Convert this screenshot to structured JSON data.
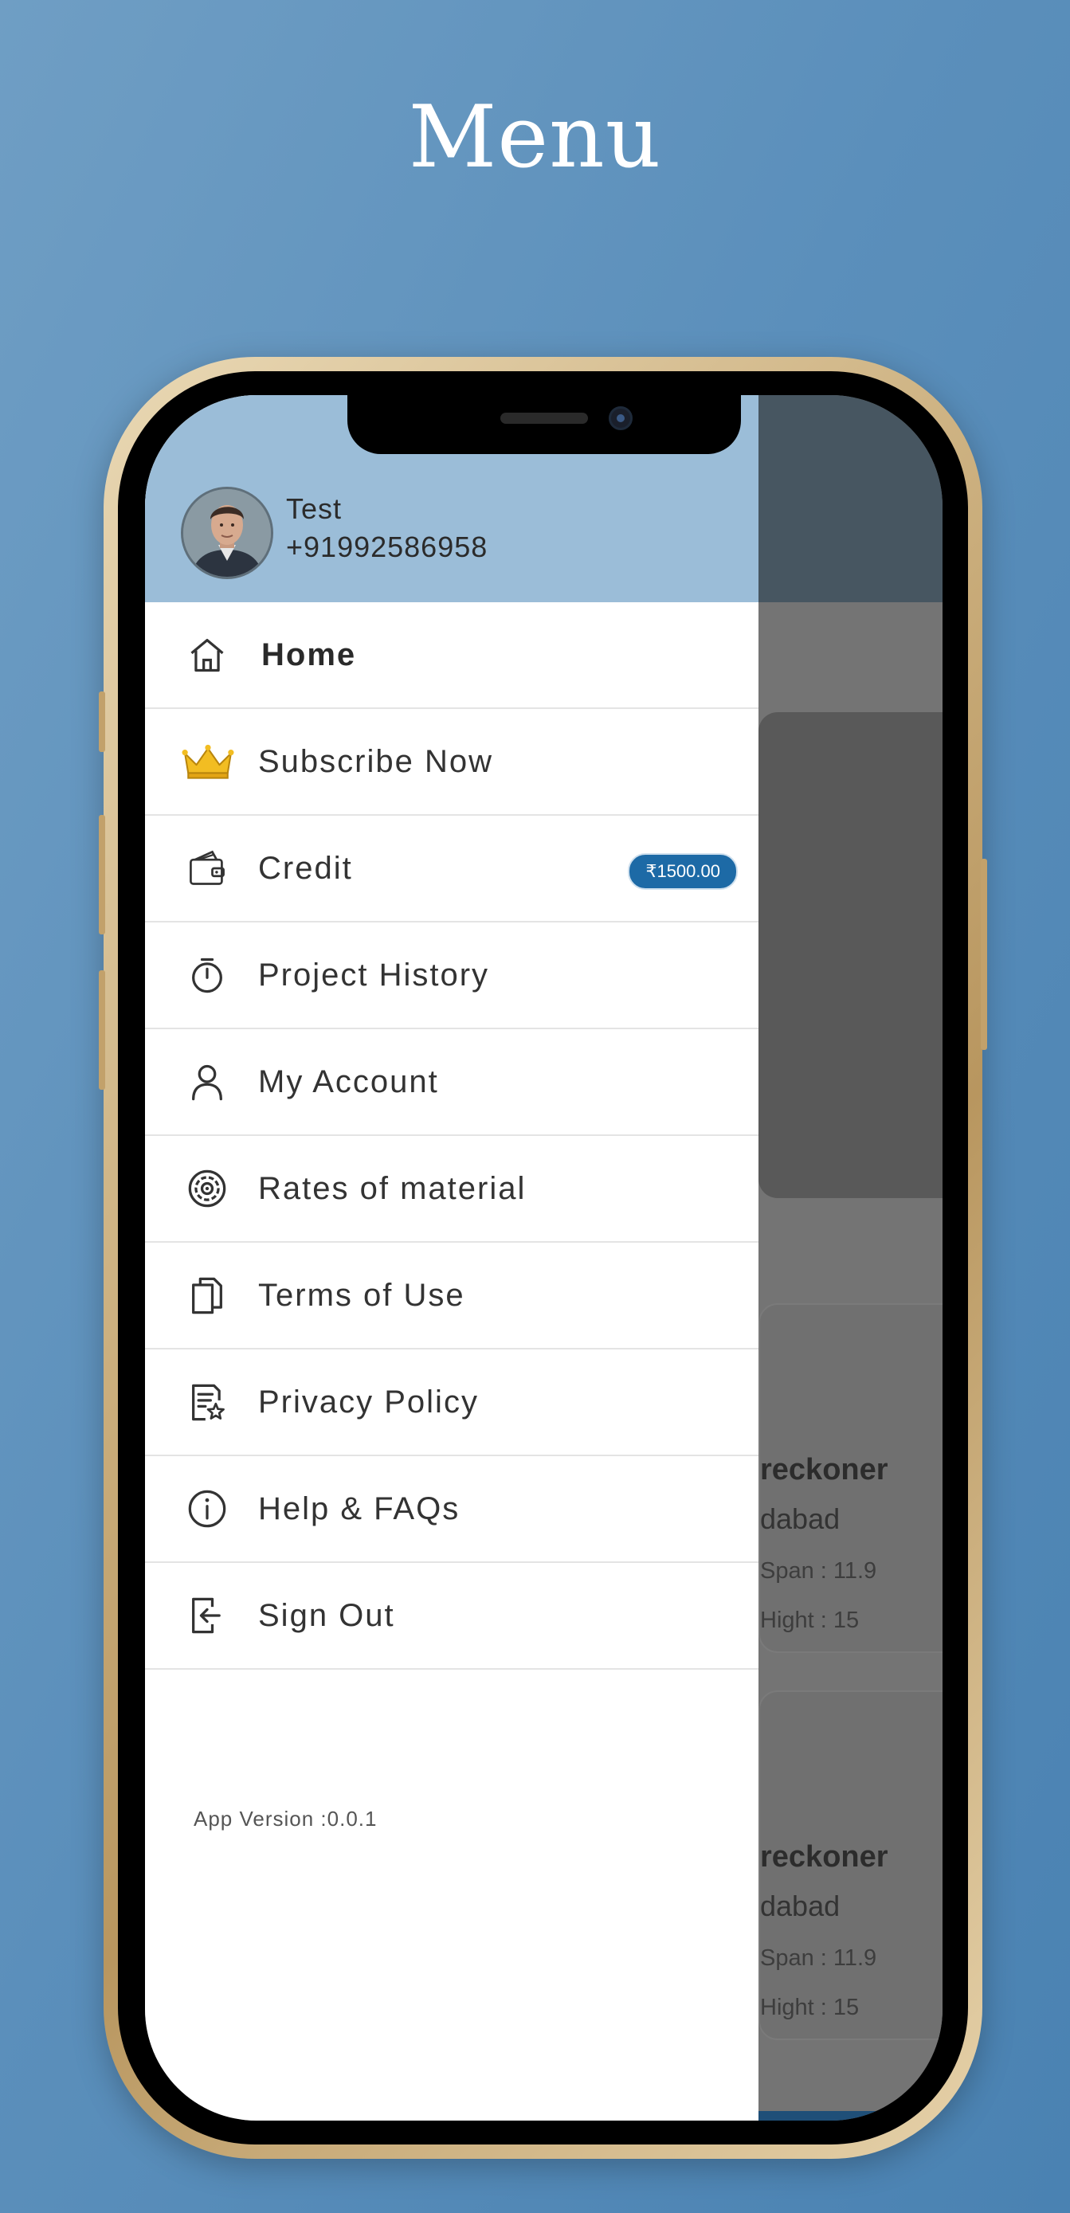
{
  "page": {
    "title": "Menu"
  },
  "drawer": {
    "user": {
      "name": "Test",
      "phone": "+91992586958"
    },
    "items": [
      {
        "label": "Home",
        "icon": "home-icon"
      },
      {
        "label": "Subscribe Now",
        "icon": "crown-icon"
      },
      {
        "label": "Credit",
        "icon": "wallet-icon",
        "badge": "₹1500.00"
      },
      {
        "label": "Project History",
        "icon": "stopwatch-icon"
      },
      {
        "label": "My Account",
        "icon": "user-icon"
      },
      {
        "label": "Rates of material",
        "icon": "target-icon"
      },
      {
        "label": "Terms of Use",
        "icon": "document-icon"
      },
      {
        "label": "Privacy Policy",
        "icon": "policy-icon"
      },
      {
        "label": "Help & FAQs",
        "icon": "info-icon"
      },
      {
        "label": "Sign Out",
        "icon": "signout-icon"
      }
    ],
    "app_version": "App Version :0.0.1"
  },
  "background": {
    "cards": [
      {
        "title": "reckoner",
        "city": "dabad",
        "span": "Span : 11.9",
        "hight": "Hight : 15"
      },
      {
        "title": "reckoner",
        "city": "dabad",
        "span": "Span : 11.9",
        "hight": "Hight : 15"
      }
    ]
  },
  "colors": {
    "drawer_header": "#9bbdd8",
    "badge": "#1d6aa6",
    "crown": "#e8b21c",
    "page_bg": "#5b8fbb"
  }
}
